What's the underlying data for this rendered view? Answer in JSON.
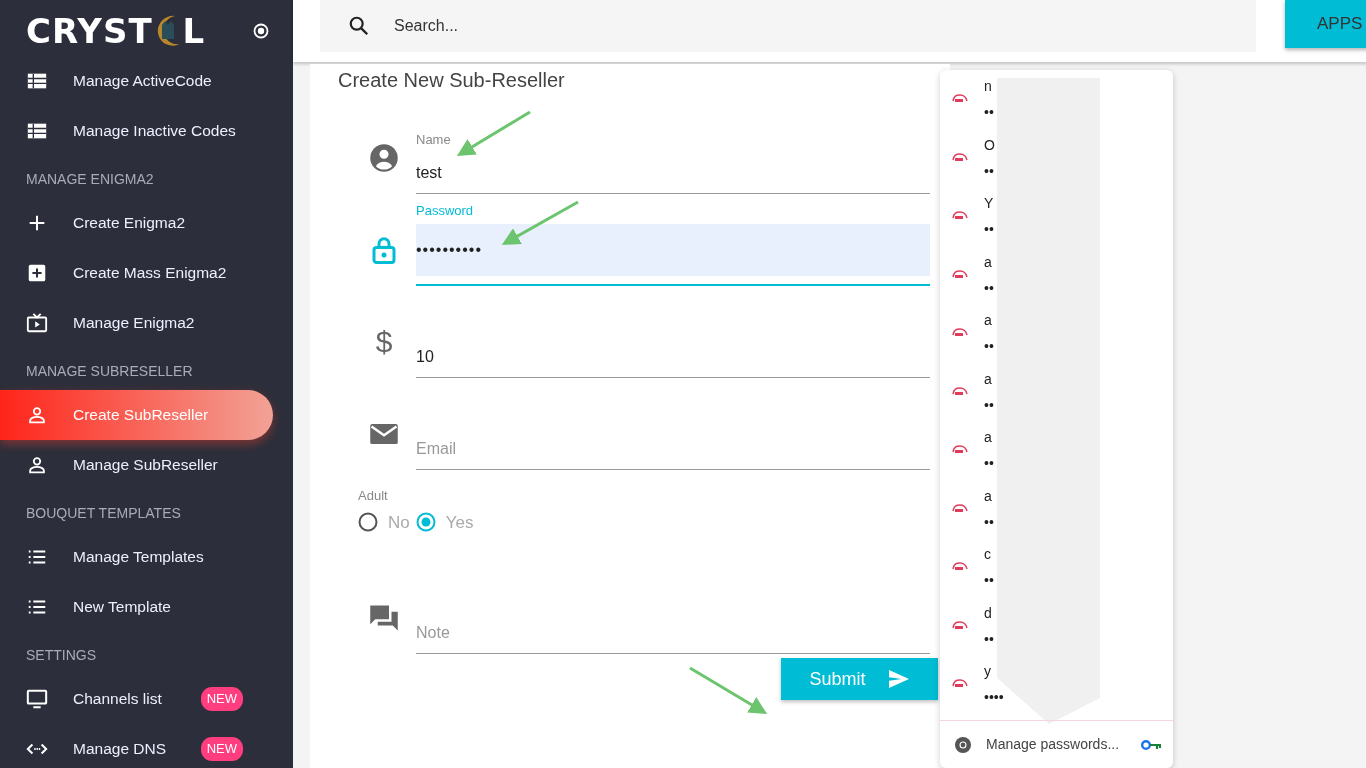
{
  "sidebar": {
    "logo": {
      "before": "CRYST",
      "after": "L"
    },
    "items": [
      {
        "kind": "item",
        "label": "Manage ActiveCode",
        "selected": false
      },
      {
        "kind": "item",
        "label": "Manage Inactive Codes",
        "selected": false
      },
      {
        "kind": "header",
        "label": "MANAGE ENIGMA2"
      },
      {
        "kind": "item",
        "label": "Create Enigma2",
        "selected": false
      },
      {
        "kind": "item",
        "label": "Create Mass Enigma2",
        "selected": false
      },
      {
        "kind": "item",
        "label": "Manage Enigma2",
        "selected": false
      },
      {
        "kind": "header",
        "label": "MANAGE SUBRESELLER"
      },
      {
        "kind": "item",
        "label": "Create SubReseller",
        "selected": true
      },
      {
        "kind": "item",
        "label": "Manage SubReseller",
        "selected": false
      },
      {
        "kind": "header",
        "label": "BOUQUET TEMPLATES"
      },
      {
        "kind": "item",
        "label": "Manage Templates",
        "selected": false
      },
      {
        "kind": "item",
        "label": "New Template",
        "selected": false
      },
      {
        "kind": "header",
        "label": "SETTINGS"
      },
      {
        "kind": "item",
        "label": "Channels list",
        "selected": false,
        "badge": "NEW"
      },
      {
        "kind": "item",
        "label": "Manage DNS",
        "selected": false,
        "badge": "NEW"
      }
    ]
  },
  "topbar": {
    "search": {
      "placeholder": "Search..."
    },
    "apps_button": "APPS"
  },
  "form": {
    "title": "Create New Sub-Reseller",
    "fields": [
      {
        "kind": "input",
        "label": "Name",
        "value": "test",
        "focused": false
      },
      {
        "kind": "input",
        "label": "Password",
        "value": "••••••••••",
        "focused": true
      },
      {
        "kind": "input",
        "icon_glyph": "$",
        "value": "10",
        "focused": false
      },
      {
        "kind": "input",
        "placeholder": "Email",
        "focused": false
      },
      {
        "kind": "radio",
        "label": "Adult",
        "options": [
          {
            "label": "No",
            "selected": false
          },
          {
            "label": "Yes",
            "selected": true
          }
        ]
      },
      {
        "kind": "input",
        "placeholder": "Note",
        "focused": false
      }
    ],
    "submit": "Submit"
  },
  "password_popup": {
    "entries": [
      {
        "username": "n",
        "secret": "••"
      },
      {
        "username": "O",
        "secret": "••"
      },
      {
        "username": "Y",
        "secret": "••"
      },
      {
        "username": "a",
        "secret": "••"
      },
      {
        "username": "a",
        "secret": "••"
      },
      {
        "username": "a",
        "secret": "••"
      },
      {
        "username": "a",
        "secret": "••"
      },
      {
        "username": "a",
        "secret": "••"
      },
      {
        "username": "c",
        "secret": "••"
      },
      {
        "username": "d",
        "secret": "••"
      },
      {
        "username": "y",
        "secret": "••••"
      }
    ],
    "footer": "Manage passwords..."
  }
}
